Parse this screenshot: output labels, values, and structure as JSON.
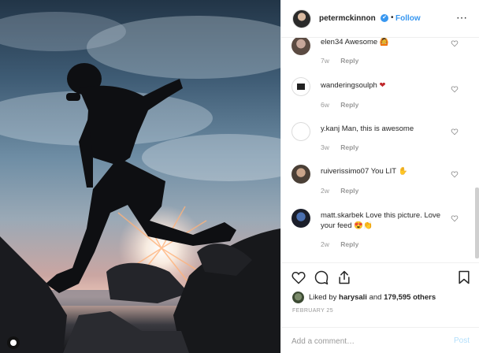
{
  "post_header": {
    "username": "petermckinnon",
    "verified_badge": "✔",
    "separator": "•",
    "follow_label": "Follow",
    "more_label": "⋯"
  },
  "comments": [
    {
      "username": "elen34",
      "text": "Awesome 🙆",
      "age": "7w",
      "reply": "Reply"
    },
    {
      "username": "wanderingsoulph",
      "text": "❤",
      "age": "6w",
      "reply": "Reply"
    },
    {
      "username": "y.kanj",
      "text": "Man, this is awesome",
      "age": "3w",
      "reply": "Reply"
    },
    {
      "username": "ruiverissimo07",
      "text": "You LIT ✋",
      "age": "2w",
      "reply": "Reply"
    },
    {
      "username": "matt.skarbek",
      "text": "Love this picture. Love your feed 😍👏",
      "age": "2w",
      "reply": "Reply"
    }
  ],
  "likes": {
    "prefix": "Liked by",
    "user": "harysali",
    "and": "and",
    "count": "179,595 others"
  },
  "date": "FEBRUARY 25",
  "add_comment": {
    "placeholder": "Add a comment…",
    "post_label": "Post"
  },
  "icons": [
    "heart-icon",
    "comment-icon",
    "share-icon",
    "bookmark-icon",
    "more-options-icon",
    "verified-icon"
  ],
  "colors": {
    "link": "#3897f0",
    "muted": "#999999",
    "heart_red": "#ed4956",
    "post_disabled": "#b2dffc"
  }
}
